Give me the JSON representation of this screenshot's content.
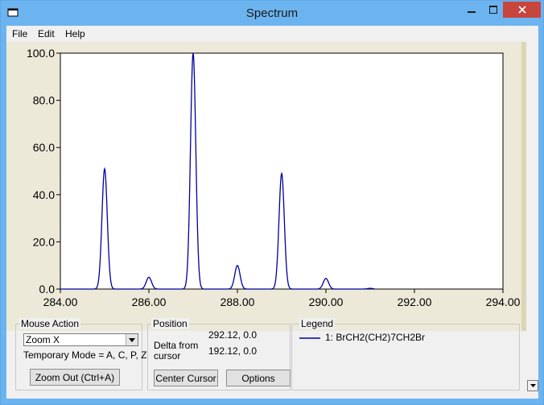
{
  "window": {
    "title": "Spectrum"
  },
  "menu": {
    "file": "File",
    "edit": "Edit",
    "help": "Help"
  },
  "chart_data": {
    "type": "line",
    "title": "",
    "xlabel": "",
    "ylabel": "",
    "xlim": [
      284.0,
      294.0
    ],
    "ylim": [
      0.0,
      100.0
    ],
    "xticks": [
      "284.00",
      "286.00",
      "288.00",
      "290.00",
      "292.00",
      "294.00"
    ],
    "yticks": [
      "0.0",
      "20.0",
      "40.0",
      "60.0",
      "80.0",
      "100.0"
    ],
    "grid": false,
    "series": [
      {
        "name": "1: BrCH2(CH2)7CH2Br",
        "color": "#0000a0",
        "peaks": [
          {
            "x": 285.0,
            "y": 51.0
          },
          {
            "x": 286.0,
            "y": 5.0
          },
          {
            "x": 287.0,
            "y": 100.0
          },
          {
            "x": 288.0,
            "y": 10.0
          },
          {
            "x": 289.0,
            "y": 49.0
          },
          {
            "x": 290.0,
            "y": 4.5
          },
          {
            "x": 291.0,
            "y": 0.3
          }
        ]
      }
    ]
  },
  "mouse_action": {
    "group_label": "Mouse Action",
    "mode_value": "Zoom X",
    "temp_mode": "Temporary Mode = A, C, P, Z",
    "zoom_out_button": "Zoom Out (Ctrl+A)"
  },
  "position": {
    "group_label": "Position",
    "cursor_value": "292.12, 0.0",
    "delta_label": "Delta from cursor",
    "delta_value": "192.12, 0.0",
    "center_cursor_button": "Center Cursor",
    "options_button": "Options"
  },
  "legend": {
    "group_label": "Legend",
    "entry": "1: BrCH2(CH2)7CH2Br"
  }
}
